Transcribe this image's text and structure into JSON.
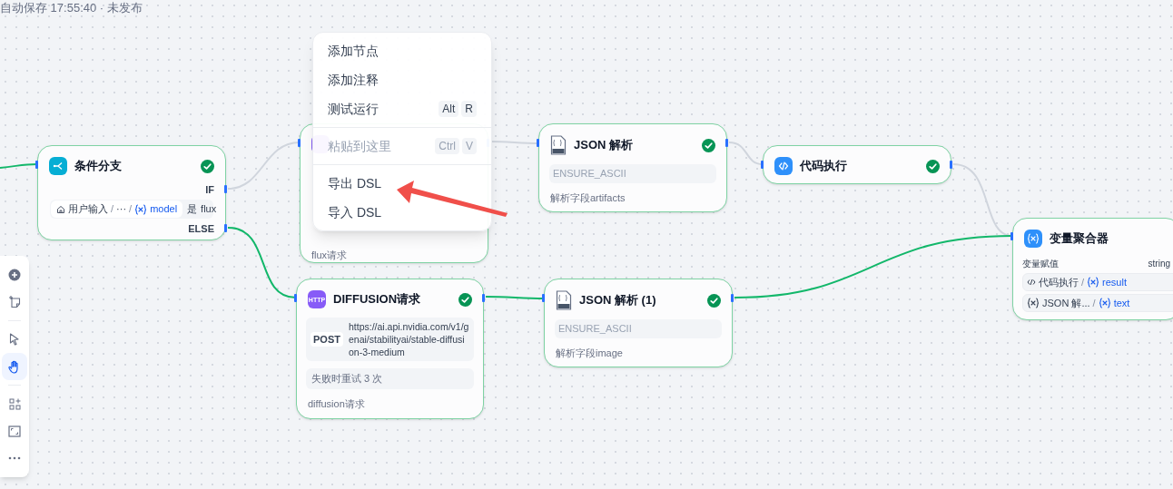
{
  "autosave": "自动保存 17:55:40 · 未发布",
  "toolbar": [
    [
      {
        "kind": "add",
        "selected": false
      },
      {
        "kind": "note",
        "selected": false
      }
    ],
    [
      {
        "kind": "pointer",
        "selected": false
      },
      {
        "kind": "hand",
        "selected": true
      }
    ],
    [
      {
        "kind": "organize",
        "selected": false
      },
      {
        "kind": "fit",
        "selected": false
      },
      {
        "kind": "more",
        "selected": false
      }
    ]
  ],
  "edges": [
    {
      "active": true
    },
    {
      "active": false
    },
    {
      "active": true
    },
    {
      "active": false
    },
    {
      "active": false
    },
    {
      "active": false
    },
    {
      "active": true
    },
    {
      "active": true
    }
  ],
  "nodes": [
    {
      "kind": "if_else",
      "title": "条件分支",
      "if_label": "IF",
      "condition": {
        "path": [
          "用户输入",
          "···"
        ],
        "separator": "/",
        "variable": "model",
        "operator": "是",
        "value": "flux"
      },
      "else_label": "ELSE"
    },
    {
      "kind": "http",
      "description": "flux请求"
    },
    {
      "kind": "json_parse",
      "title": "JSON 解析",
      "field": "ENSURE_ASCII",
      "description": "解析字段artifacts"
    },
    {
      "kind": "code",
      "title": "代码执行"
    },
    {
      "kind": "http",
      "icon_text": "HTTP",
      "title": "DIFFUSION请求",
      "method": "POST",
      "url": "https://ai.api.nvidia.com/v1/genai/stabilityai/stable-diffusion-3-medium",
      "retry": "失败时重试 3 次",
      "description": "diffusion请求"
    },
    {
      "kind": "json_parse",
      "title": "JSON 解析 (1)",
      "field": "ENSURE_ASCII",
      "description": "解析字段image"
    },
    {
      "kind": "aggregator",
      "title": "变量聚合器",
      "label": "变量赋值",
      "type": "string",
      "separator": "/",
      "vars": [
        {
          "kind": "code",
          "source": "代码执行",
          "variable": "result"
        },
        {
          "kind": "variable",
          "source": "JSON 解...",
          "variable": "text"
        }
      ]
    }
  ],
  "context_menu": [
    [
      {
        "label": "添加节点",
        "disabled": false
      },
      {
        "label": "添加注释",
        "disabled": false
      },
      {
        "label": "测试运行",
        "disabled": false,
        "shortcut": [
          "Alt",
          "R"
        ]
      }
    ],
    [
      {
        "label": "粘贴到这里",
        "disabled": true,
        "shortcut": [
          "Ctrl",
          "V"
        ]
      }
    ],
    [
      {
        "label": "导出 DSL",
        "disabled": false
      },
      {
        "label": "导入 DSL",
        "disabled": false
      }
    ]
  ]
}
